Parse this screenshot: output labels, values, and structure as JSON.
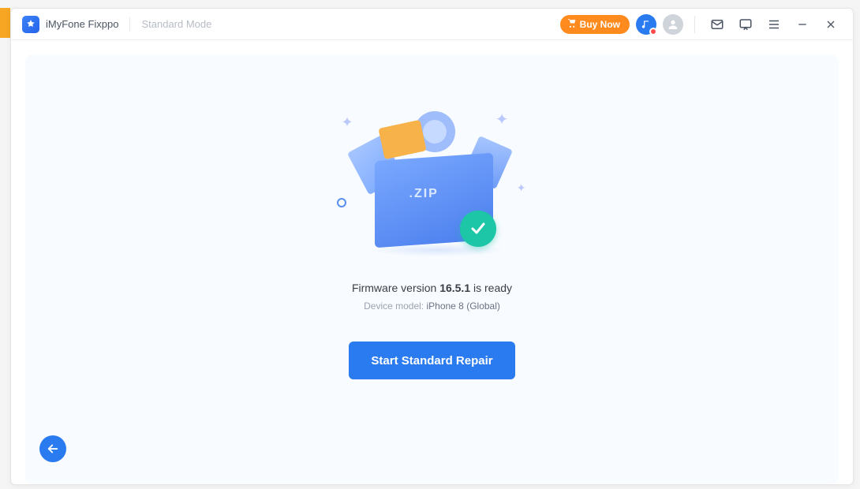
{
  "titlebar": {
    "app_name": "iMyFone Fixppo",
    "mode": "Standard Mode",
    "buy_now": "Buy Now"
  },
  "main": {
    "firmware_prefix": "Firmware version ",
    "firmware_version": "16.5.1",
    "firmware_suffix": " is ready",
    "device_prefix": "Device model: ",
    "device_model": "iPhone 8 (Global)",
    "start_button": "Start Standard Repair",
    "zip_label": ".ZIP"
  }
}
